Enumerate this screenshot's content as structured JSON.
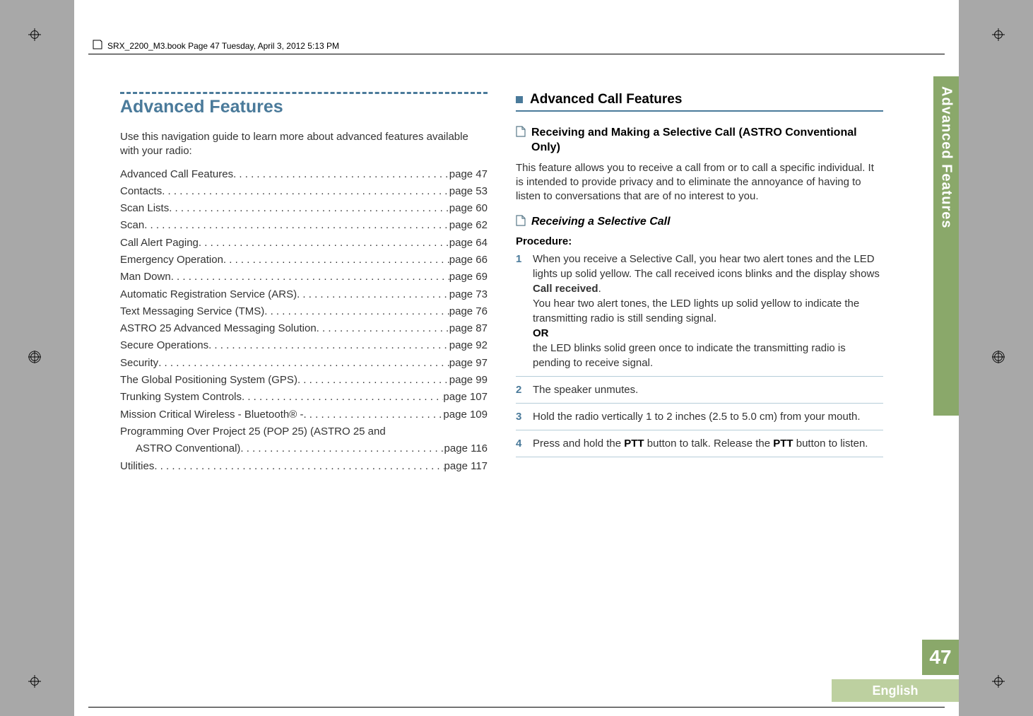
{
  "header": {
    "book_info": "SRX_2200_M3.book  Page 47  Tuesday, April 3, 2012  5:13 PM"
  },
  "left": {
    "title": "Advanced Features",
    "intro": "Use this navigation guide to learn more about advanced features available with your radio:",
    "toc": [
      {
        "label": "Advanced Call Features",
        "page": "page 47"
      },
      {
        "label": "Contacts",
        "page": "page 53"
      },
      {
        "label": "Scan Lists",
        "page": "page 60"
      },
      {
        "label": "Scan",
        "page": "page 62"
      },
      {
        "label": "Call Alert Paging",
        "page": "page 64"
      },
      {
        "label": "Emergency Operation",
        "page": "page 66"
      },
      {
        "label": "Man Down",
        "page": "page 69"
      },
      {
        "label": "Automatic Registration Service (ARS)",
        "page": "page 73"
      },
      {
        "label": "Text Messaging Service (TMS)",
        "page": "page 76"
      },
      {
        "label": "ASTRO 25 Advanced Messaging Solution",
        "page": "page 87"
      },
      {
        "label": "Secure Operations",
        "page": "page 92"
      },
      {
        "label": "Security",
        "page": "page 97"
      },
      {
        "label": "The Global Positioning System (GPS)",
        "page": "page 99"
      },
      {
        "label": "Trunking System Controls",
        "page": "page 107"
      },
      {
        "label": "Mission Critical Wireless - Bluetooth® -",
        "page": "page 109"
      },
      {
        "label": "Programming Over Project 25 (POP 25) (ASTRO 25 and",
        "page": ""
      },
      {
        "label": "ASTRO Conventional)",
        "page": "page 116",
        "sub": true
      },
      {
        "label": "Utilities",
        "page": "page 117"
      }
    ]
  },
  "right": {
    "h2": "Advanced Call Features",
    "proc1_title": "Receiving and Making a Selective Call (ASTRO Conventional Only)",
    "proc1_body": "This feature allows you to receive a call from or to call a specific individual. It is intended to provide privacy and to eliminate the annoyance of having to listen to conversations that are of no interest to you.",
    "proc2_title": "Receiving a Selective Call",
    "procedure_label": "Procedure:",
    "steps": {
      "s1a": "When you receive a Selective Call, you hear two alert tones and the LED lights up solid yellow. The call received icons blinks and the display shows ",
      "s1_display": "Call received",
      "s1b": ".",
      "s1c": "You hear two alert tones, the LED lights up solid yellow to indicate the transmitting radio is still sending signal.",
      "s1_or": "OR",
      "s1d": "the LED blinks solid green once to indicate the transmitting radio is pending to receive signal.",
      "s2": "The speaker unmutes.",
      "s3": "Hold the radio vertically 1 to 2 inches (2.5 to 5.0 cm) from your mouth.",
      "s4a": "Press and hold the ",
      "s4_ptt1": "PTT",
      "s4b": " button to talk. Release the ",
      "s4_ptt2": "PTT",
      "s4c": " button to listen."
    }
  },
  "side_tab": "Advanced Features",
  "page_number": "47",
  "language": "English"
}
